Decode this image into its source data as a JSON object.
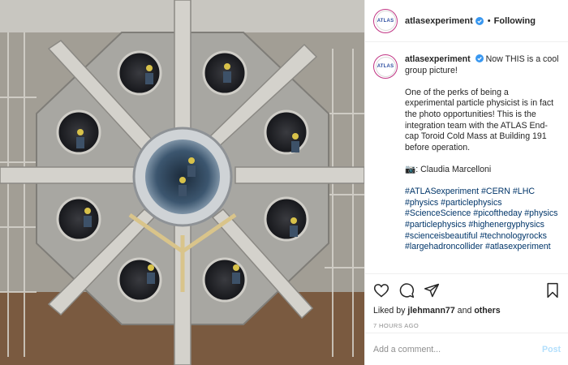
{
  "header": {
    "username": "atlasexperiment",
    "avatar_text": "ATLAS",
    "separator": "•",
    "follow_status": "Following",
    "more_icon": "more-horizontal-icon"
  },
  "caption": {
    "username": "atlasexperiment",
    "line1": "Now THIS is a cool group picture!",
    "paragraph": "One of the perks of being a experimental particle physicist is in fact the photo opportunities! This is the integration team with the ATLAS End-cap Toroid Cold Mass at Building 191 before operation.",
    "credit": "📷: Claudia Marcelloni",
    "hashtags": [
      "#ATLASexperiment",
      "#CERN",
      "#LHC",
      "#physics",
      "#particlephysics",
      "#ScienceScience",
      "#picoftheday",
      "#physics",
      "#particlephysics",
      "#highenergyphysics",
      "#scienceisbeautiful",
      "#technologyrocks",
      "#largehadroncollider",
      "#atlasexperiment"
    ]
  },
  "actions": {
    "liked_prefix": "Liked by",
    "liked_user": "jlehmann77",
    "liked_and": "and",
    "liked_others": "others",
    "timestamp": "7 HOURS AGO"
  },
  "comment_box": {
    "placeholder": "Add a comment...",
    "post_label": "Post"
  },
  "colors": {
    "verified": "#3897f0",
    "link": "#003569",
    "post_disabled": "#b2dffc"
  }
}
